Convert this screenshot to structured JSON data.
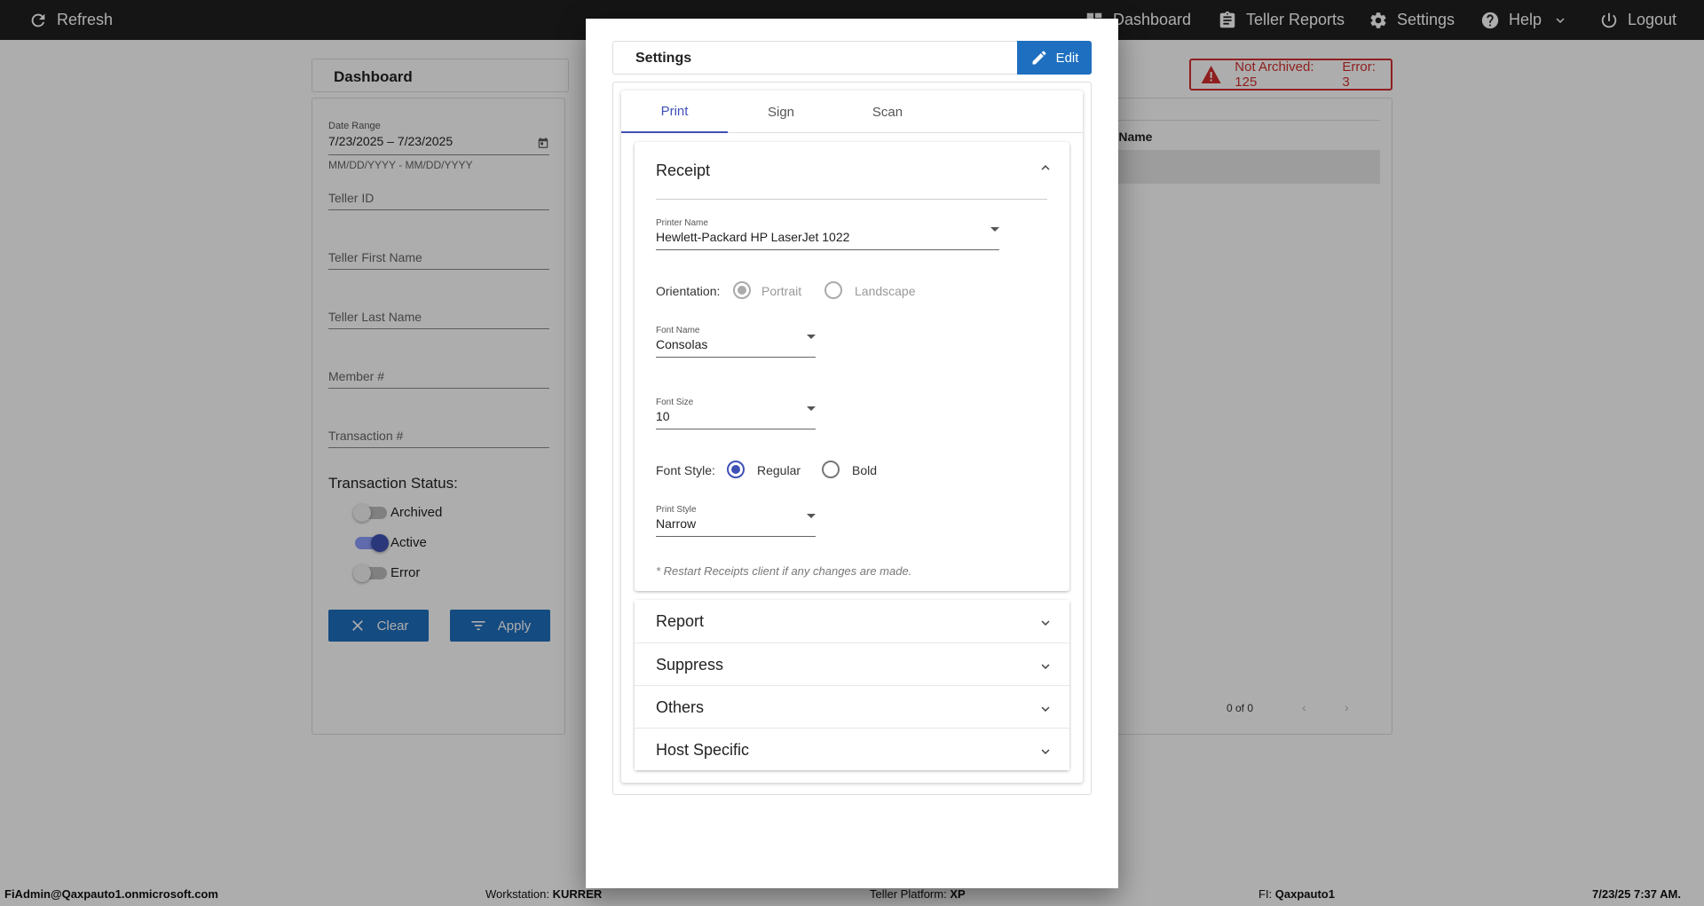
{
  "topbar": {
    "refresh": "Refresh",
    "dashboard": "Dashboard",
    "teller_reports": "Teller Reports",
    "settings": "Settings",
    "help": "Help",
    "logout": "Logout"
  },
  "page": {
    "title": "Dashboard"
  },
  "alert": {
    "not_archived": "Not Archived: 125",
    "error": "Error: 3",
    "color": "#d32f2f"
  },
  "filters": {
    "date_range_label": "Date Range",
    "date_range_value": "7/23/2025 – 7/23/2025",
    "date_hint": "MM/DD/YYYY - MM/DD/YYYY",
    "teller_id": "Teller ID",
    "teller_first_name": "Teller First Name",
    "teller_last_name": "Teller Last Name",
    "member": "Member #",
    "transaction": "Transaction #",
    "status_label": "Transaction Status:",
    "statuses": [
      {
        "label": "Archived",
        "on": false
      },
      {
        "label": "Active",
        "on": true
      },
      {
        "label": "Error",
        "on": false
      }
    ],
    "clear": "Clear",
    "apply": "Apply"
  },
  "results": {
    "column_fragment": "r Name",
    "pager": "0 of 0"
  },
  "footer": {
    "user": "FiAdmin@Qaxpauto1.onmicrosoft.com",
    "workstation_label": "Workstation:",
    "workstation": "KURRER",
    "platform_label": "Teller Platform:",
    "platform": "XP",
    "fi_label": "FI:",
    "fi": "Qaxpauto1",
    "datetime": "7/23/25 7:37 AM."
  },
  "modal": {
    "title": "Settings",
    "edit": "Edit",
    "tabs": [
      "Print",
      "Sign",
      "Scan"
    ],
    "active_tab": "Print",
    "receipt": {
      "title": "Receipt",
      "printer_label": "Printer Name",
      "printer_value": "Hewlett-Packard HP LaserJet 1022",
      "orientation_label": "Orientation:",
      "portrait": "Portrait",
      "landscape": "Landscape",
      "font_name_label": "Font Name",
      "font_name_value": "Consolas",
      "font_size_label": "Font Size",
      "font_size_value": "10",
      "font_style_label": "Font Style:",
      "regular": "Regular",
      "bold": "Bold",
      "print_style_label": "Print Style",
      "print_style_value": "Narrow",
      "note": "* Restart Receipts client if any changes are made."
    },
    "sections": [
      "Report",
      "Suppress",
      "Others",
      "Host Specific"
    ]
  },
  "colors": {
    "accent": "#3f51b5",
    "button": "#1e6fbf",
    "topbar": "#202020"
  }
}
